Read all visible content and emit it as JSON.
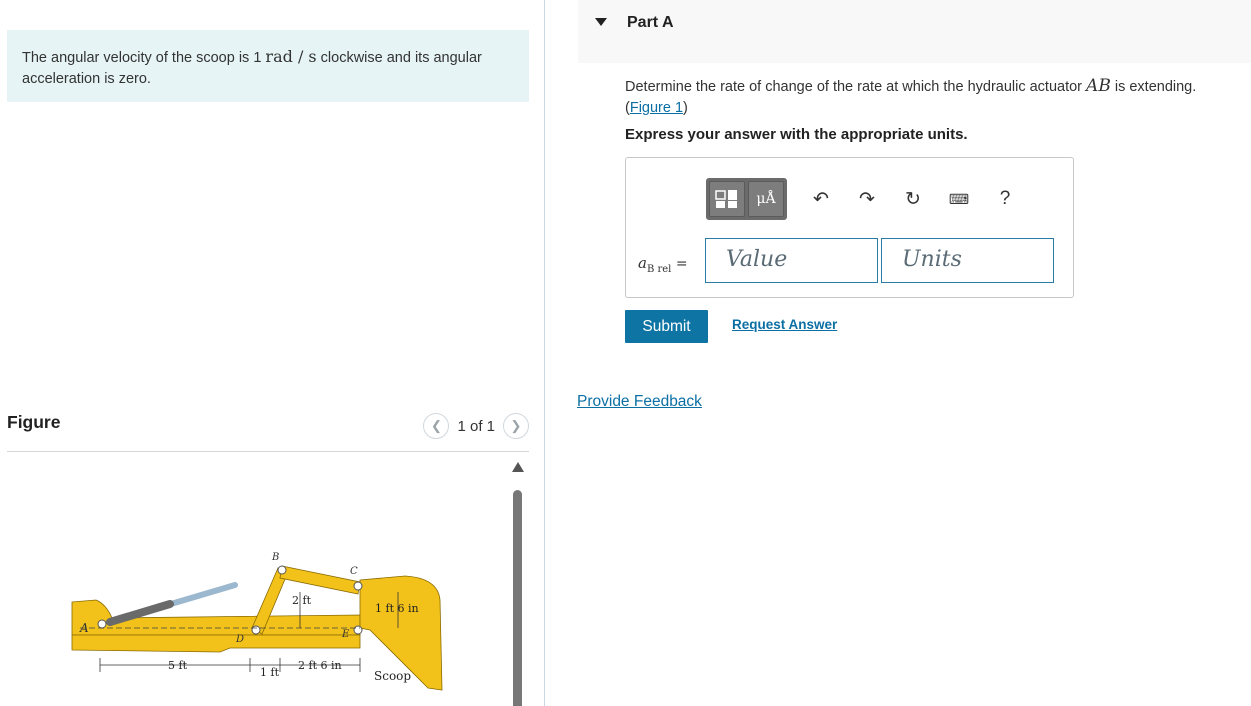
{
  "problem": {
    "text_before": "The angular velocity of the scoop is 1",
    "unit": "rad / s",
    "text_after": "clockwise and its angular acceleration is zero."
  },
  "figure": {
    "title": "Figure",
    "pager_text": "1 of 1",
    "labels": {
      "A": "A",
      "B": "B",
      "C": "C",
      "D": "D",
      "E": "E",
      "dim_2ft": "2 ft",
      "dim_1ft6in": "1 ft 6 in",
      "dim_5ft": "5 ft",
      "dim_1ft": "1 ft",
      "dim_2ft6in": "2 ft 6 in",
      "scoop": "Scoop"
    }
  },
  "part": {
    "title": "Part A",
    "question_before": "Determine the rate of change of the rate at which the hydraulic actuator",
    "question_var": "AB",
    "question_after": "is extending.",
    "figure_link": "Figure 1",
    "instruction": "Express your answer with the appropriate units."
  },
  "answer": {
    "label_var": "a",
    "label_sub": "B rel",
    "label_eq": "=",
    "value_placeholder": "Value",
    "units_placeholder": "Units"
  },
  "toolbar": {
    "templates_icon": "templates-icon",
    "units_button": "μÅ",
    "help": "?"
  },
  "actions": {
    "submit": "Submit",
    "request_answer": "Request Answer",
    "provide_feedback": "Provide Feedback"
  },
  "colors": {
    "accent": "#0e74a4",
    "problem_bg": "#e6f4f5",
    "scoop_yellow": "#f2c21b"
  }
}
